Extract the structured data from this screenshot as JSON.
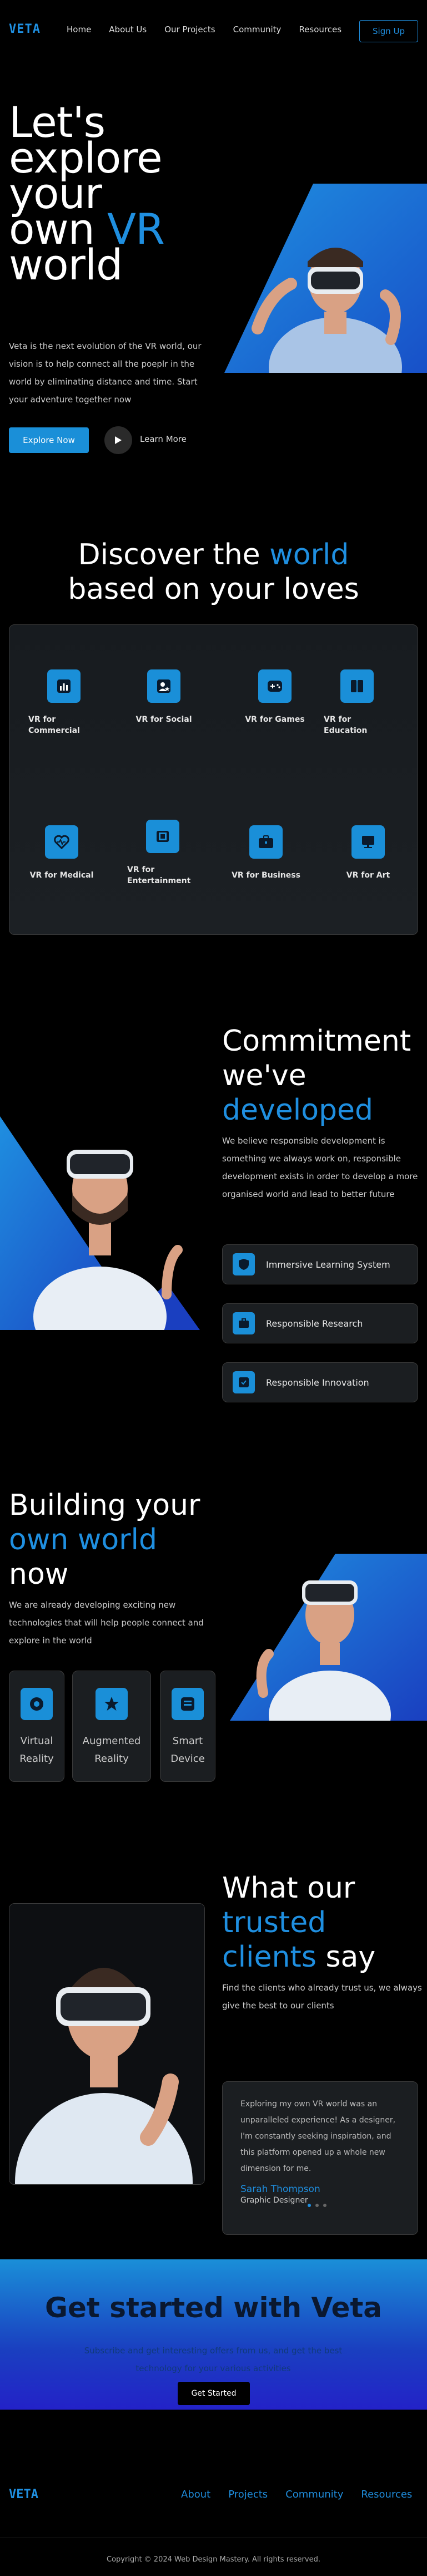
{
  "brand": {
    "logo": "VETA",
    "accent": "#1f8fe0"
  },
  "nav": {
    "items": [
      "Home",
      "About Us",
      "Our Projects",
      "Community",
      "Resources"
    ],
    "signup": "Sign Up"
  },
  "hero": {
    "title_line1": "Let's",
    "title_line2": "explore",
    "title_line3": "your",
    "title_line4a": "own",
    "title_line4b": "VR",
    "title_line5": "world",
    "description": "Veta is the next evolution of the VR world, our vision is to help connect all the poeplr in the world by eliminating distance and time. Start your adventure together now",
    "primary_button": "Explore Now",
    "secondary_button": "Learn More"
  },
  "discover": {
    "title_a": "Discover the",
    "title_b": "world",
    "title_c": "based on your loves",
    "categories": [
      {
        "label": "VR for Commercial",
        "icon": "bar-chart-icon"
      },
      {
        "label": "VR for Social",
        "icon": "social-icon"
      },
      {
        "label": "VR for Games",
        "icon": "gamepad-icon"
      },
      {
        "label": "VR for Education",
        "icon": "book-icon"
      },
      {
        "label": "VR for Medical",
        "icon": "heart-icon"
      },
      {
        "label": "VR for Entertainment",
        "icon": "ticket-icon"
      },
      {
        "label": "VR for Business",
        "icon": "briefcase-icon"
      },
      {
        "label": "VR for Art",
        "icon": "easel-icon"
      }
    ]
  },
  "commitment": {
    "title_a": "Commitment",
    "title_b": "we've",
    "title_c": "developed",
    "description": "We believe responsible development is something we always work on, responsible development exists in order to develop a more organised world and lead to better future",
    "items": [
      "Immersive Learning System",
      "Responsible Research",
      "Responsible Innovation"
    ]
  },
  "building": {
    "title_a": "Building your",
    "title_b": "own world",
    "title_c": "now",
    "description": "We are already developing exciting new technologies that will help people connect and explore in the world",
    "cards": [
      {
        "label_a": "Virtual",
        "label_b": "Reality"
      },
      {
        "label_a": "Augmented",
        "label_b": "Reality"
      },
      {
        "label_a": "Smart",
        "label_b": "Device"
      }
    ]
  },
  "testimonials": {
    "title_a": "What our",
    "title_b": "trusted",
    "title_c": "clients",
    "title_d": "say",
    "description": "Find the clients who already trust us, we always give the best to our clients",
    "quote": "Exploring my own VR world was an unparalleled experience! As a designer, I'm constantly seeking inspiration, and this platform opened up a whole new dimension for me.",
    "name": "Sarah Thompson",
    "role": "Graphic Designer"
  },
  "cta": {
    "title": "Get started with Veta",
    "description": "Subscribe and get interesting offers from us, and get the best technology for your various activities",
    "button": "Get Started"
  },
  "footer": {
    "logo": "VETA",
    "links": [
      "About",
      "Projects",
      "Community",
      "Resources"
    ],
    "copyright": "Copyright © 2024 Web Design Mastery. All rights reserved."
  }
}
